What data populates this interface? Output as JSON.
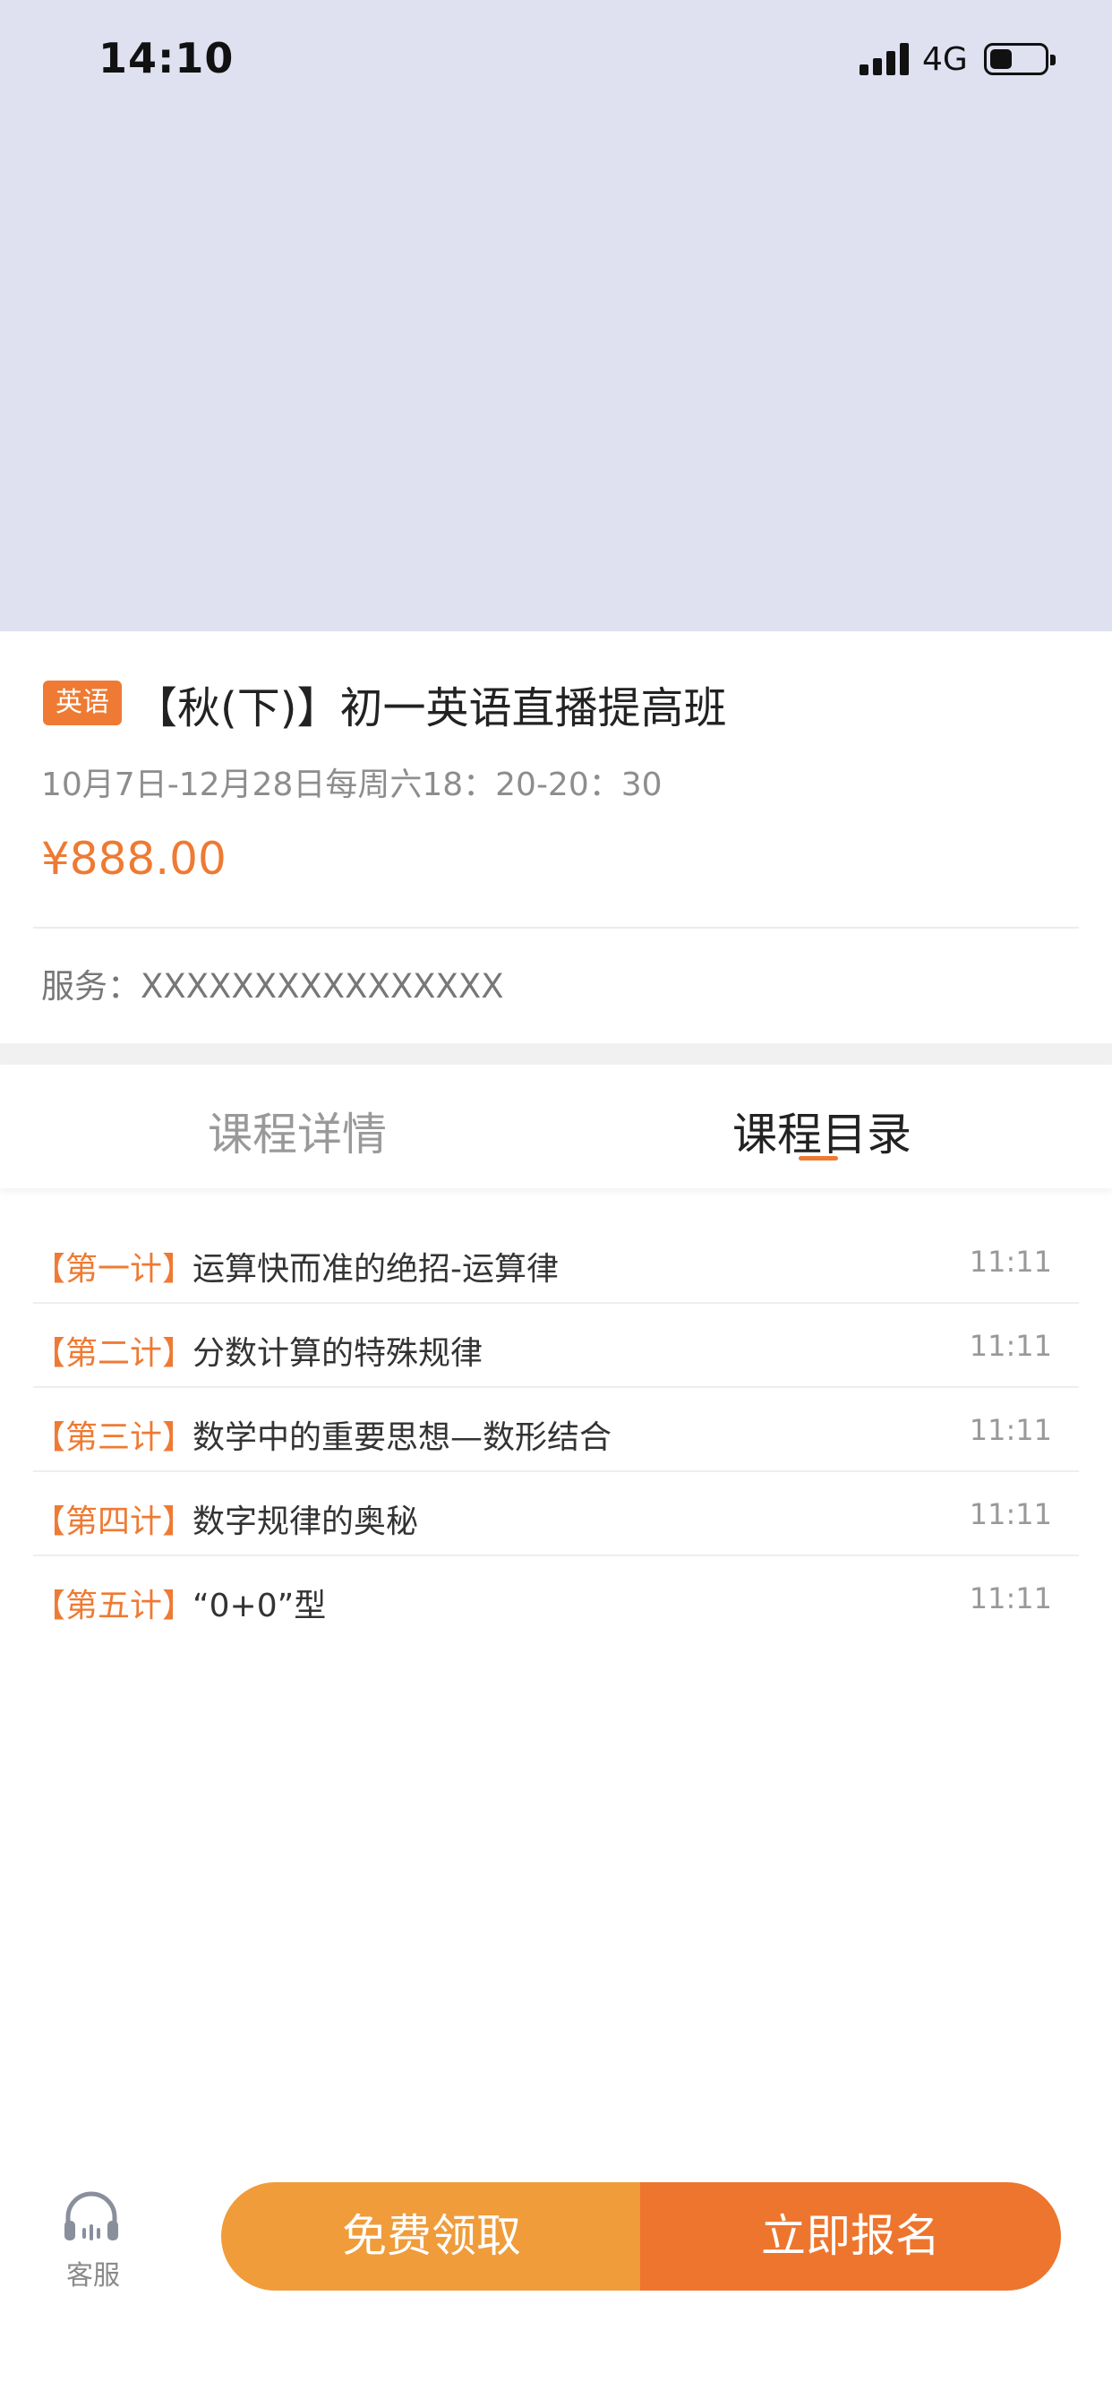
{
  "status_bar": {
    "time": "14:10",
    "network": "4G"
  },
  "course": {
    "subject_badge": "英语",
    "title": "【秋(下)】初一英语直播提高班",
    "schedule": "10月7日-12月28日每周六18：20-20：30",
    "price": "¥888.00",
    "service_label": "服务：",
    "service_value": "XXXXXXXXXXXXXXXX"
  },
  "tabs": [
    {
      "label": "课程详情",
      "active": false
    },
    {
      "label": "课程目录",
      "active": true
    }
  ],
  "lessons": [
    {
      "tag": "【第一计】",
      "name": "运算快而准的绝招-运算律",
      "time": "11:11"
    },
    {
      "tag": "【第二计】",
      "name": "分数计算的特殊规律",
      "time": "11:11"
    },
    {
      "tag": "【第三计】",
      "name": "数学中的重要思想—数形结合",
      "time": "11:11"
    },
    {
      "tag": "【第四计】",
      "name": "数字规律的奥秘",
      "time": "11:11"
    },
    {
      "tag": "【第五计】",
      "name": "“0+0”型",
      "time": "11:11"
    }
  ],
  "bottom_bar": {
    "service_label": "客服",
    "service_icon": "headset-icon",
    "free_button": "免费领取",
    "enroll_button": "立即报名"
  },
  "colors": {
    "accent": "#ee7a33",
    "banner_bg": "#dfe0f0",
    "free_button": "#f09c3a",
    "enroll_button": "#ee752d"
  }
}
